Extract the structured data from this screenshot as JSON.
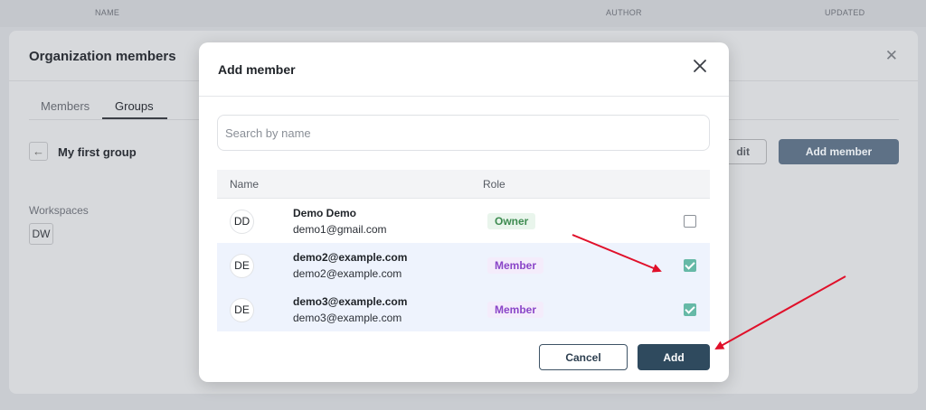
{
  "background_table": {
    "columns": [
      "NAME",
      "AUTHOR",
      "UPDATED"
    ]
  },
  "org_panel": {
    "title": "Organization members",
    "close_icon": "close-icon",
    "tabs": [
      {
        "label": "Members",
        "active": false
      },
      {
        "label": "Groups",
        "active": true
      }
    ],
    "back_icon": "arrow-left-icon",
    "group_title": "My first group",
    "edit_label": "dit",
    "add_member_label": "Add member",
    "workspaces_label": "Workspaces",
    "workspace_badge": "DW"
  },
  "modal": {
    "title": "Add member",
    "close_icon": "close-icon",
    "search_placeholder": "Search by name",
    "columns": {
      "name": "Name",
      "role": "Role"
    },
    "members": [
      {
        "initials": "DD",
        "name": "Demo Demo",
        "email": "demo1@gmail.com",
        "role": "Owner",
        "checked": false
      },
      {
        "initials": "DE",
        "name": "demo2@example.com",
        "email": "demo2@example.com",
        "role": "Member",
        "checked": true
      },
      {
        "initials": "DE",
        "name": "demo3@example.com",
        "email": "demo3@example.com",
        "role": "Member",
        "checked": true
      }
    ],
    "cancel_label": "Cancel",
    "add_label": "Add"
  },
  "colors": {
    "primary_button": "#2f4a5e",
    "checkbox_checked": "#66b9a7",
    "owner_text": "#3d8b50",
    "member_text": "#8a45c8",
    "annotation_arrow": "#e0102a"
  }
}
